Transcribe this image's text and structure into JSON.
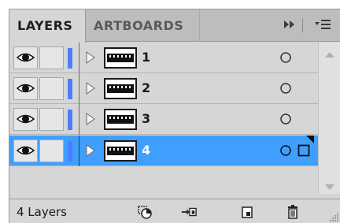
{
  "tabs": {
    "layers_label": "LAYERS",
    "artboards_label": "ARTBOARDS"
  },
  "toolbar_icons": [
    "fast-forward-icon",
    "panel-menu-icon"
  ],
  "layers": [
    {
      "name": "1",
      "visible": true,
      "locked": false,
      "selected": false,
      "color": "#4f7cff"
    },
    {
      "name": "2",
      "visible": true,
      "locked": false,
      "selected": false,
      "color": "#4f7cff"
    },
    {
      "name": "3",
      "visible": true,
      "locked": false,
      "selected": false,
      "color": "#4f7cff"
    },
    {
      "name": "4",
      "visible": true,
      "locked": false,
      "selected": true,
      "color": "#4f7cff"
    }
  ],
  "footer": {
    "count_label": "4 Layers",
    "buttons": [
      "locate-object-icon",
      "make-clipping-mask-icon",
      "create-new-sublayer-icon",
      "create-new-layer-icon",
      "delete-icon"
    ]
  },
  "colors": {
    "selection": "#3f9fff",
    "layer_color": "#4f7cff",
    "panel_bg": "#d6d6d6"
  }
}
